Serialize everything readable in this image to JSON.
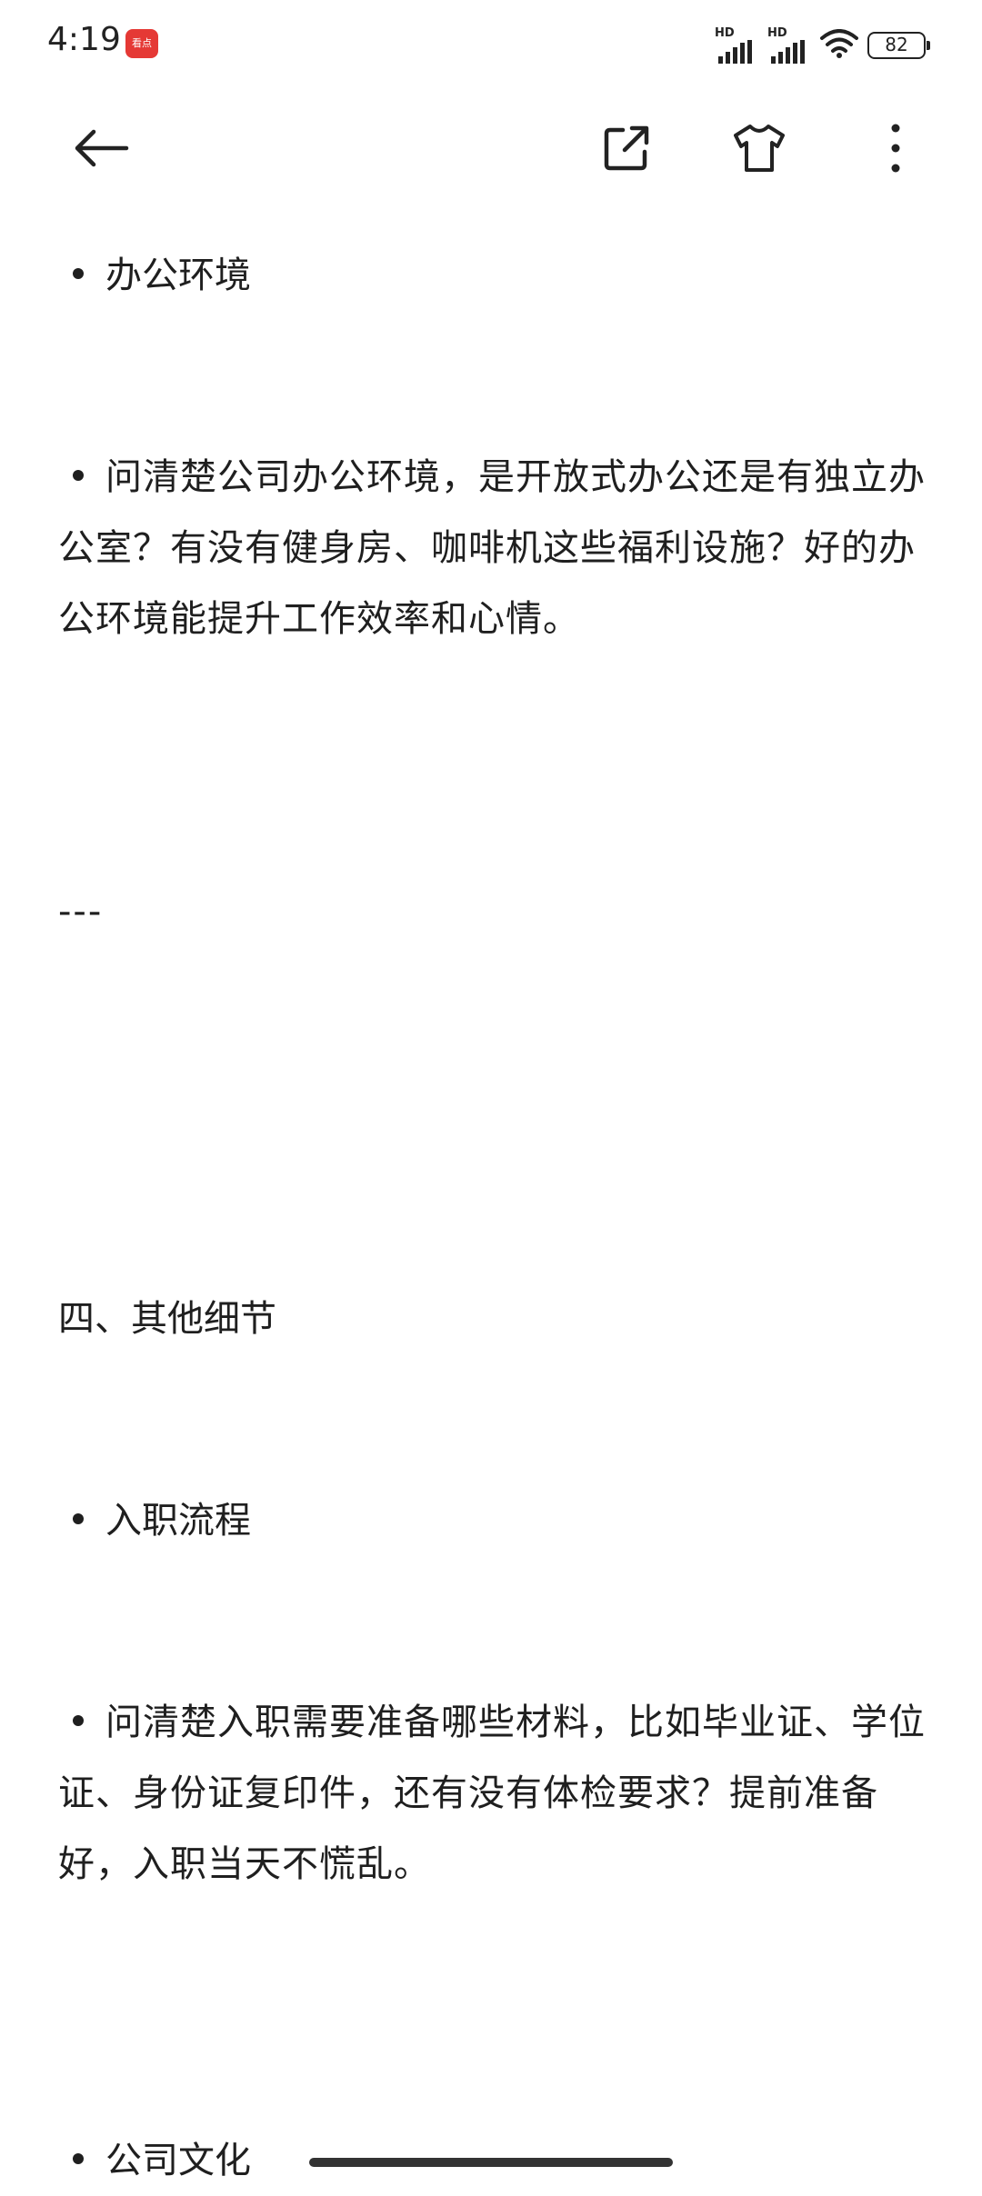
{
  "status_bar": {
    "time": "4:19",
    "app_badge_label": "看点",
    "signal_labels": [
      "HD",
      "HD"
    ],
    "battery": "82",
    "icons": [
      "app-badge-icon",
      "signal-icon",
      "signal-icon",
      "wifi-icon",
      "battery-icon"
    ]
  },
  "toolbar": {
    "back_icon": "arrow-left-icon",
    "share_icon": "external-link-icon",
    "theme_icon": "tshirt-icon",
    "more_icon": "more-vertical-icon"
  },
  "content": {
    "item1_heading": "办公环境",
    "item1_text": "问清楚公司办公环境，是开放式办公还是有独立办公室？有没有健身房、咖啡机这些福利设施？好的办公环境能提升工作效率和心情。",
    "divider": "---",
    "section_title": "四、其他细节",
    "item2_heading": "入职流程",
    "item2_text": "问清楚入职需要准备哪些材料，比如毕业证、学位证、身份证复印件，还有没有体检要求？提前准备好，入职当天不慌乱。",
    "item3_heading": "公司文化"
  }
}
